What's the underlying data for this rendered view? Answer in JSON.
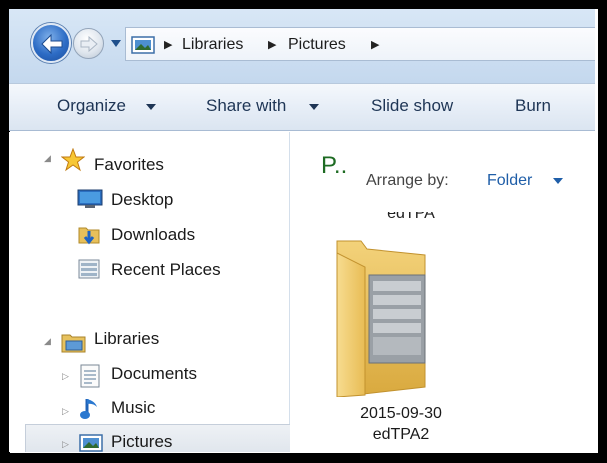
{
  "address_bar": {
    "breadcrumbs": [
      "Libraries",
      "Pictures"
    ]
  },
  "command_bar": {
    "organize": "Organize",
    "share_with": "Share with",
    "slide_show": "Slide show",
    "burn": "Burn"
  },
  "nav_pane": {
    "favorites": {
      "label": "Favorites",
      "items": [
        "Desktop",
        "Downloads",
        "Recent Places"
      ]
    },
    "libraries": {
      "label": "Libraries",
      "items": [
        "Documents",
        "Music",
        "Pictures"
      ],
      "selected": "Pictures"
    }
  },
  "content": {
    "library_title": "P..",
    "arrange_label": "Arrange by:",
    "arrange_value": "Folder",
    "partial_item_label": "edTPA",
    "items": [
      {
        "name_line1": "2015-09-30",
        "name_line2": "edTPA2",
        "icon": "folder-icon"
      }
    ]
  },
  "colors": {
    "frame": "#000000",
    "title_green": "#1e6b23",
    "link_blue": "#1f5ea8",
    "command_text": "#1e3555"
  }
}
